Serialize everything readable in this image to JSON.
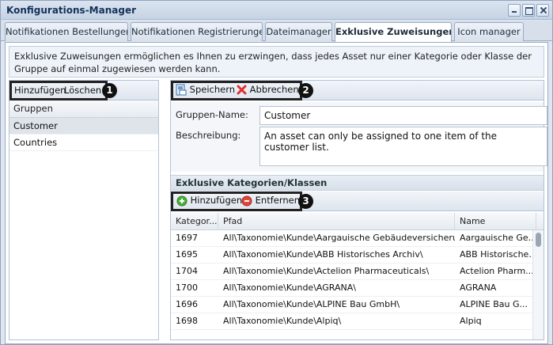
{
  "window": {
    "title": "Konfigurations-Manager"
  },
  "tabs": [
    {
      "label": "Notifikationen Bestellungen",
      "active": false
    },
    {
      "label": "Notifikationen Registrierungen",
      "active": false
    },
    {
      "label": "Dateimanager",
      "active": false
    },
    {
      "label": "Exklusive Zuweisungen",
      "active": true
    },
    {
      "label": "Icon manager",
      "active": false
    }
  ],
  "info": {
    "text": "Exklusive Zuweisungen ermöglichen es Ihnen zu erzwingen, dass jedes Asset nur einer Kategorie oder Klasse der Gruppe auf einmal zugewiesen werden kann."
  },
  "left": {
    "toolbar": {
      "add_label": "Hinzufügen",
      "delete_label": "Löschen",
      "badge": "1"
    },
    "header": "Gruppen",
    "groups": [
      "Customer",
      "Countries"
    ]
  },
  "right": {
    "toolbar": {
      "save_label": "Speichern",
      "cancel_label": "Abbrechen",
      "badge": "2"
    },
    "form": {
      "name_label": "Gruppen-Name:",
      "name_value": "Customer",
      "desc_label": "Beschreibung:",
      "desc_value": "An asset can only be assigned to one item of the customer list."
    },
    "section_title": "Exklusive Kategorien/Klassen",
    "subtoolbar": {
      "add_label": "Hinzufügen",
      "remove_label": "Entfernen",
      "badge": "3"
    },
    "table": {
      "columns": [
        "Kategor...",
        "Pfad",
        "Name"
      ],
      "rows": [
        [
          "1697",
          "All\\Taxonomie\\Kunde\\Aargauische Gebäudeversicherun...",
          "Aargauische Ge..."
        ],
        [
          "1695",
          "All\\Taxonomie\\Kunde\\ABB Historisches Archiv\\",
          "ABB Historische..."
        ],
        [
          "1704",
          "All\\Taxonomie\\Kunde\\Actelion Pharmaceuticals\\",
          "Actelion Pharm..."
        ],
        [
          "1700",
          "All\\Taxonomie\\Kunde\\AGRANA\\",
          "AGRANA"
        ],
        [
          "1696",
          "All\\Taxonomie\\Kunde\\ALPINE Bau GmbH\\",
          "ALPINE Bau G..."
        ],
        [
          "1698",
          "All\\Taxonomie\\Kunde\\Alpiq\\",
          "Alpiq"
        ]
      ]
    }
  }
}
